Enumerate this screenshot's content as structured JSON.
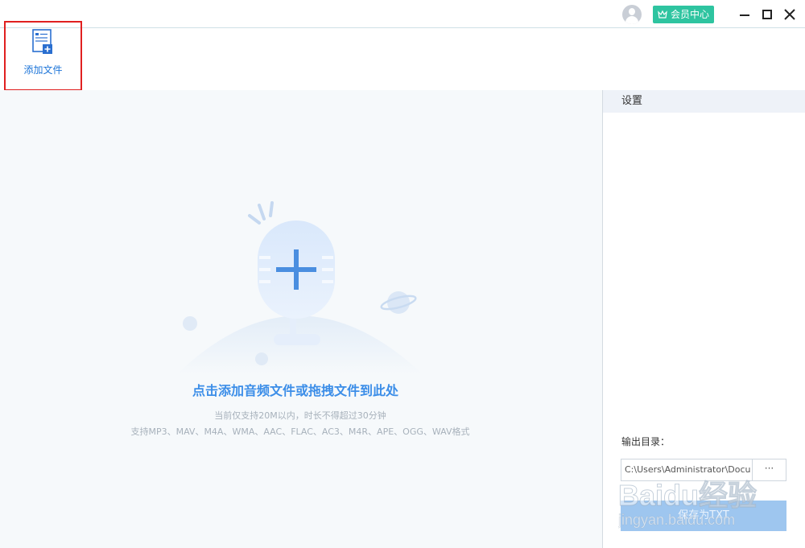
{
  "titlebar": {
    "vip_label": "会员中心"
  },
  "toolbar": {
    "add_file_label": "添加文件"
  },
  "main": {
    "drop_title": "点击添加音频文件或拖拽文件到此处",
    "drop_limit": "当前仅支持20M以内，时长不得超过30分钟",
    "drop_formats": "支持MP3、MAV、M4A、WMA、AAC、FLAC、AC3、M4R、APE、OGG、WAV格式"
  },
  "settings": {
    "header": "设置",
    "output_label": "输出目录：",
    "output_path": "C:\\Users\\Administrator\\Docu",
    "browse_label": "···",
    "save_label": "保存为TXT"
  },
  "watermark": {
    "brand": "Baidu经验",
    "url": "jingyan.baidu.com"
  },
  "colors": {
    "accent": "#3c8ee8",
    "vip": "#2ec4a0",
    "highlight_box": "#e02020",
    "save_button": "#9ec6ef"
  },
  "icons": [
    "user-avatar-icon",
    "crown-icon",
    "minimize-icon",
    "maximize-icon",
    "close-icon",
    "add-file-icon",
    "microphone-plus-icon"
  ]
}
